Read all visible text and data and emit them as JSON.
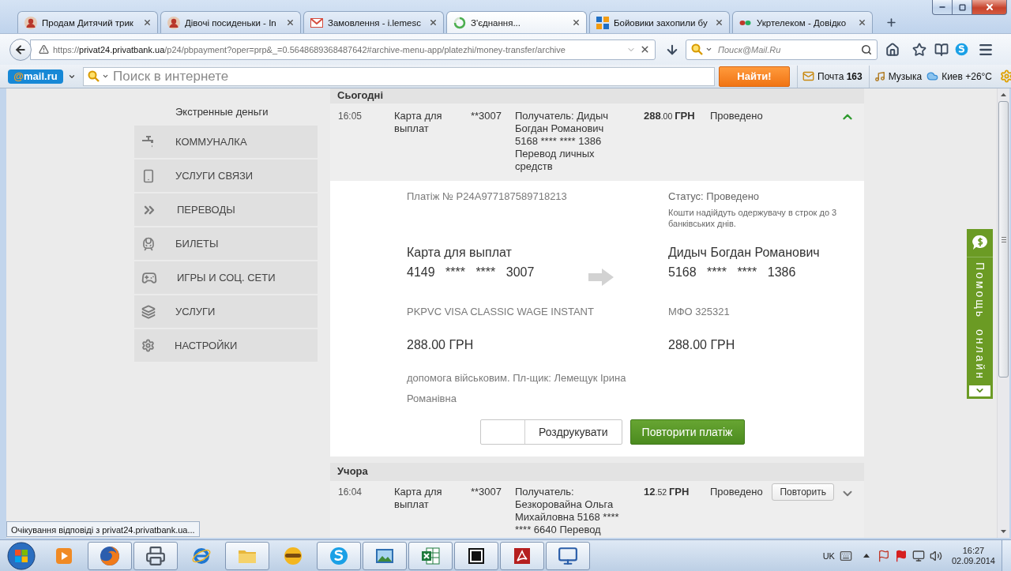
{
  "tabs": [
    {
      "kind": "avatar",
      "title": "Продам Дитячий трик",
      "selected": false
    },
    {
      "kind": "avatar",
      "title": "Дівочі посиденьки - In",
      "selected": false
    },
    {
      "kind": "mail",
      "title": "Замовлення - i.lemesc",
      "selected": false
    },
    {
      "kind": "loading",
      "title": "З'єднання...",
      "selected": true
    },
    {
      "kind": "tiles",
      "title": "Бойовики захопили бу",
      "selected": false
    },
    {
      "kind": "dots",
      "title": "Укртелеком - Довідко",
      "selected": false
    }
  ],
  "navigation": {
    "url": "https://**privat24.privatbank.ua**/p24/pbpayment?oper=prp&_=0.5648689368487642#archive-menu-app/platezhi/money-transfer/archive",
    "search_placeholder": "Поиск@Mail.Ru"
  },
  "mail_toolbar": {
    "logo": "**@**mail.ru",
    "search_placeholder": "Поиск в интернете",
    "search_button": "Найти!",
    "mail": "Почта **163**",
    "music": "Музыка",
    "weather": "Киев +26°C"
  },
  "sidebar": {
    "title": "Экстренные деньги",
    "items": [
      {
        "kind": "utilities",
        "label": "КОММУНАЛКА",
        "selected": false
      },
      {
        "kind": "telecom",
        "label": "УСЛУГИ СВЯЗИ",
        "selected": false
      },
      {
        "kind": "transfers",
        "label": "ПЕРЕВОДЫ",
        "selected": false
      },
      {
        "kind": "tickets",
        "label": "БИЛЕТЫ",
        "selected": false
      },
      {
        "kind": "games",
        "label": "ИГРЫ И СОЦ. СЕТИ",
        "selected": false
      },
      {
        "kind": "services",
        "label": "УСЛУГИ",
        "selected": false
      },
      {
        "kind": "settings",
        "label": "НАСТРОЙКИ",
        "selected": false
      }
    ]
  },
  "sections": [
    {
      "title": "Сьогодні",
      "transactions": [
        {
          "time": "16:05",
          "card": "Карта для выплат",
          "card_suffix": "**3007",
          "recipient": "Получатель: Дидыч Богдан Романович 5168 **** **** 1386 Перевод личных средств",
          "amount": "**288**.00 **ГРН**",
          "status": "Проведено",
          "expanded": true,
          "details": {
            "payment_no": "Платіж № P24A977187589718213",
            "status": "Статус: Проведено",
            "status_note": "Кошти надійдуть одержувачу в строк до 3 банківських днів.",
            "sender": {
              "name": "Карта для выплат",
              "card": "4149 **** **** 3007",
              "product": "PKPVC VISA CLASSIC WAGE INSTANT",
              "amount": "288.00 ГРН"
            },
            "receiver": {
              "name": "Дидыч Богдан Романович",
              "card": "5168 **** **** 1386",
              "bank": "МФО 325321",
              "amount": "288.00 ГРН"
            },
            "purpose": "допомога військовим. Пл-щик: Лемещук Ірина Романівна",
            "print_label": "Роздрукувати",
            "repeat_label": "Повторити платіж"
          }
        }
      ]
    },
    {
      "title": "Учора",
      "transactions": [
        {
          "time": "16:04",
          "card": "Карта для выплат",
          "card_suffix": "**3007",
          "recipient": "Получатель: Безкоровайна Ольга Михайловна 5168 **** **** 6640 Перевод",
          "amount": "**12**.52 **ГРН**",
          "status": "Проведено",
          "expanded": false,
          "repeat_label": "Повторить"
        }
      ]
    }
  ],
  "help_widget": {
    "label": "Помощь онлайн"
  },
  "status_text": "Очікування відповіді з privat24.privatbank.ua...",
  "taskbar": {
    "apps": [
      {
        "kind": "media",
        "running": false
      },
      {
        "kind": "browser",
        "running": true
      },
      {
        "kind": "printer",
        "running": true
      },
      {
        "kind": "globe",
        "running": false
      },
      {
        "kind": "folder",
        "running": true
      },
      {
        "kind": "ball",
        "running": false
      },
      {
        "kind": "bubble",
        "running": true
      },
      {
        "kind": "picture",
        "running": true
      },
      {
        "kind": "spreadsheet",
        "running": true
      },
      {
        "kind": "archive",
        "running": true
      },
      {
        "kind": "document",
        "running": true
      },
      {
        "kind": "monitor",
        "running": true
      }
    ],
    "language": "UK",
    "time": "16:27",
    "date": "02.09.2014"
  }
}
